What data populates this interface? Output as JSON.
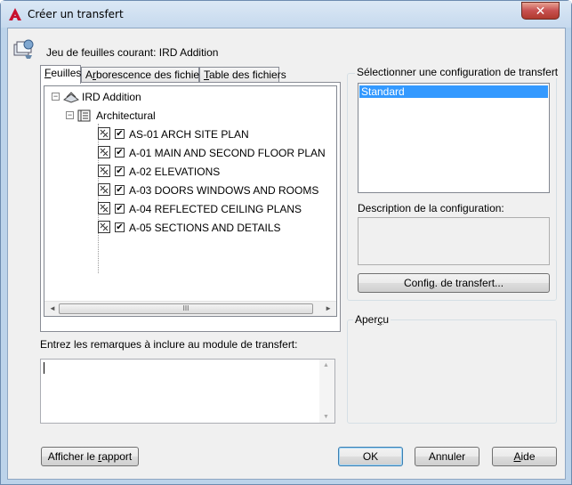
{
  "window": {
    "title": "Créer un transfert",
    "close_glyph": "✕"
  },
  "current_sheet_set": {
    "label": "Jeu de feuilles courant: IRD Addition"
  },
  "tabs": [
    {
      "label_pre": "",
      "label_u": "F",
      "label_post": "euilles",
      "active": true
    },
    {
      "label_pre": "A",
      "label_u": "r",
      "label_post": "borescence des fichiers",
      "active": false
    },
    {
      "label_pre": "",
      "label_u": "T",
      "label_post": "able des fichiers",
      "active": false
    }
  ],
  "tree": {
    "root": {
      "label": "IRD Addition",
      "icon": "sheet-set-icon",
      "expander": "−"
    },
    "subset": {
      "label": "Architectural",
      "icon": "subset-icon",
      "expander": "−"
    },
    "sheets": [
      {
        "label": "AS-01 ARCH SITE PLAN",
        "checked": "✔"
      },
      {
        "label": "A-01 MAIN AND SECOND FLOOR PLAN",
        "checked": "✔"
      },
      {
        "label": "A-02 ELEVATIONS",
        "checked": "✔"
      },
      {
        "label": "A-03 DOORS WINDOWS AND ROOMS",
        "checked": "✔"
      },
      {
        "label": "A-04 REFLECTED CEILING PLANS",
        "checked": "✔"
      },
      {
        "label": "A-05 SECTIONS AND DETAILS",
        "checked": "✔"
      }
    ],
    "scroll": {
      "left": "◄",
      "right": "►",
      "thumb": "III"
    }
  },
  "notes": {
    "label": "Entrez les remarques à inclure au module de transfert:",
    "value": ""
  },
  "config": {
    "group_label": "Sélectionner une configuration de transfert",
    "options": [
      "Standard"
    ],
    "selected": "Standard",
    "description_label": "Description de la configuration:",
    "button_pre": "Confi",
    "button_u": "g",
    "button_post": ". de transfert..."
  },
  "preview": {
    "label_pre": "Aper",
    "label_u": "ç",
    "label_post": "u"
  },
  "buttons": {
    "report_pre": "Afficher le ",
    "report_u": "r",
    "report_post": "apport",
    "ok": "OK",
    "cancel": "Annuler",
    "help_pre": "",
    "help_u": "A",
    "help_post": "ide"
  },
  "colors": {
    "selection": "#3399ff",
    "close_button": "#c75050",
    "app_icon": "#c8102e"
  }
}
